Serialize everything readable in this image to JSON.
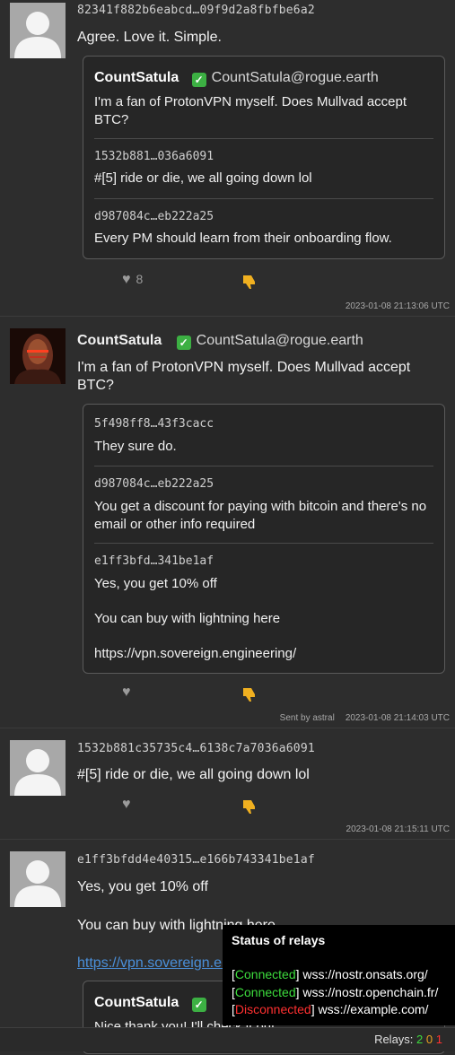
{
  "posts": [
    {
      "id": "82341f882b6eabcd…09f9d2a8fbfbe6a2",
      "text": "Agree. Love it. Simple.",
      "quote": {
        "author": "CountSatula",
        "nip05": "CountSatula@rogue.earth",
        "text": "I'm a fan of ProtonVPN myself. Does Mullvad accept BTC?",
        "replies": [
          {
            "id": "1532b881…036a6091",
            "text": "#[5] ride or die, we all going down lol"
          },
          {
            "id": "d987084c…eb222a25",
            "text": "Every PM should learn from their onboarding flow."
          }
        ]
      },
      "likes": "8",
      "timestamp": "2023-01-08 21:13:06 UTC"
    },
    {
      "author": "CountSatula",
      "nip05": "CountSatula@rogue.earth",
      "text": "I'm a fan of ProtonVPN myself. Does Mullvad accept BTC?",
      "replies": [
        {
          "id": "5f498ff8…43f3cacc",
          "text": "They sure do."
        },
        {
          "id": "d987084c…eb222a25",
          "text": "You get a discount for paying with bitcoin and there's no email or other info required"
        },
        {
          "id": "e1ff3bfd…341be1af",
          "text1": "Yes, you get 10% off",
          "text2": "You can buy with lightning here",
          "text3": "https://vpn.sovereign.engineering/"
        }
      ],
      "sent_by": "Sent by astral",
      "timestamp": "2023-01-08 21:14:03 UTC"
    },
    {
      "id": "1532b881c35735c4…6138c7a7036a6091",
      "text": "#[5] ride or die, we all going down lol",
      "timestamp": "2023-01-08 21:15:11 UTC"
    },
    {
      "id": "e1ff3bfdd4e40315…e166b743341be1af",
      "text1": "Yes, you get 10% off",
      "text2": "You can buy with lightning here",
      "link": "https://vpn.sovereign.engineering/",
      "quote_author": "CountSatula",
      "quote_text": "Nice thank you! I'll check it out"
    }
  ],
  "relay_popup": {
    "title": "Status of relays",
    "relays": [
      {
        "status": "Connected",
        "url": "wss://nostr.onsats.org/"
      },
      {
        "status": "Connected",
        "url": "wss://nostr.openchain.fr/"
      },
      {
        "status": "Disconnected",
        "url": "wss://example.com/"
      }
    ]
  },
  "statusbar": {
    "label": "Relays:",
    "connected": "2",
    "pending": "0",
    "disconnected": "1"
  },
  "colors": {
    "connected": "#3ddc3d",
    "disconnected": "#ff3030",
    "pending": "#e8a020"
  }
}
